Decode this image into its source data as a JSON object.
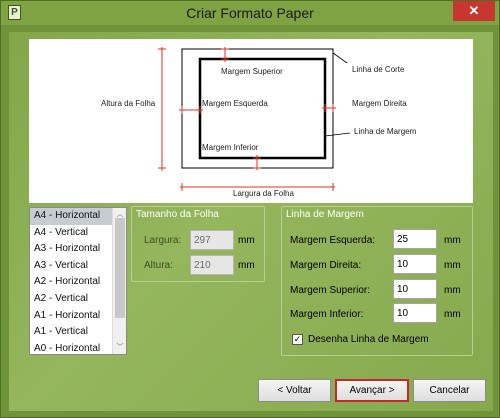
{
  "window": {
    "title": "Criar Formato Paper",
    "close_glyph": "✕",
    "icon_letter": "P"
  },
  "diagram": {
    "labels": {
      "top_margin": "Margem Superior",
      "cut_line": "Linha de Corte",
      "sheet_height": "Altura da Folha",
      "left_margin": "Margem Esquerda",
      "right_margin": "Margem Direita",
      "margin_line": "Linha de Margem",
      "bottom_margin": "Margem Inferior",
      "sheet_width": "Largura da Folha"
    },
    "colors": {
      "marker": "#e0312a",
      "frame": "#000000"
    }
  },
  "formats": {
    "items": [
      "A4 - Horizontal",
      "A4 - Vertical",
      "A3 - Horizontal",
      "A3 - Vertical",
      "A2 - Horizontal",
      "A2 - Vertical",
      "A1 - Horizontal",
      "A1 - Vertical",
      "A0 - Horizontal"
    ],
    "selected": "A4 - Horizontal"
  },
  "sheet_size": {
    "title": "Tamanho da Folha",
    "width_label": "Largura:",
    "width_value": "297",
    "height_label": "Altura:",
    "height_value": "210",
    "unit": "mm"
  },
  "margin_line": {
    "title": "Linha de Margem",
    "left_label": "Margem Esquerda:",
    "left_value": "25",
    "right_label": "Margem Direita:",
    "right_value": "10",
    "top_label": "Margem Superior:",
    "top_value": "10",
    "bottom_label": "Margem Inferior:",
    "bottom_value": "10",
    "unit": "mm",
    "draw_label": "Desenha Linha de Margem",
    "draw_checked": true,
    "check_glyph": "✓"
  },
  "buttons": {
    "back": "< Voltar",
    "next": "Avançar >",
    "cancel": "Cancelar"
  }
}
